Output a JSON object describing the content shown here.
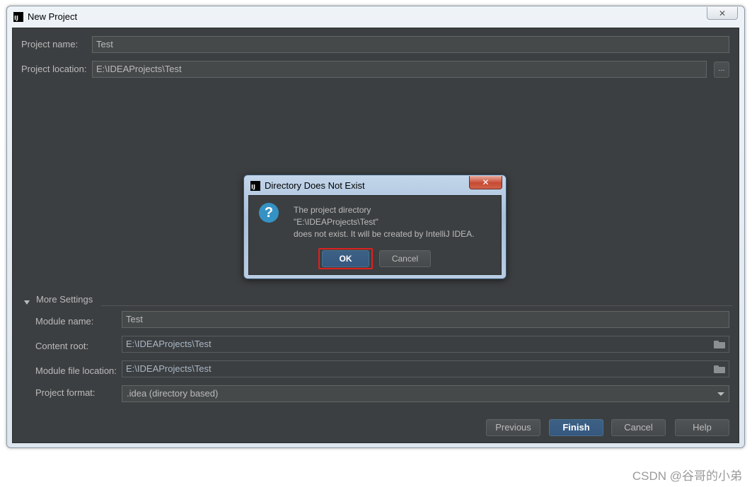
{
  "window": {
    "title": "New Project",
    "logo_text": "IJ",
    "close_glyph": "✕"
  },
  "form": {
    "project_name_label": "Project name:",
    "project_name_value": "Test",
    "project_location_label": "Project location:",
    "project_location_value": "E:\\IDEAProjects\\Test",
    "browse_label": "..."
  },
  "more_settings": {
    "title": "More Settings",
    "expanded": true,
    "module_name_label": "Module name:",
    "module_name_value": "Test",
    "content_root_label": "Content root:",
    "content_root_value": "E:\\IDEAProjects\\Test",
    "module_file_location_label": "Module file location:",
    "module_file_location_value": "E:\\IDEAProjects\\Test",
    "project_format_label": "Project format:",
    "project_format_value": ".idea (directory based)"
  },
  "buttons": {
    "previous": "Previous",
    "finish": "Finish",
    "cancel": "Cancel",
    "help": "Help"
  },
  "dialog": {
    "title": "Directory Does Not Exist",
    "logo_text": "IJ",
    "close_glyph": "✕",
    "icon_glyph": "?",
    "message_line1": "The project directory",
    "message_line2": "\"E:\\IDEAProjects\\Test\"",
    "message_line3": "does not exist. It will be created by IntelliJ IDEA.",
    "ok_label": "OK",
    "cancel_label": "Cancel"
  },
  "watermark": "CSDN @谷哥的小弟",
  "colors": {
    "ide_background": "#3c3f41",
    "primary_button": "#365880",
    "focus_highlight": "#e02020",
    "question_icon": "#3592c4"
  }
}
